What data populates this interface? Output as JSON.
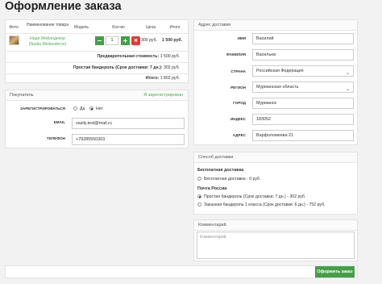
{
  "page": {
    "title": "Оформление заказа"
  },
  "order": {
    "columns": [
      "Фото",
      "Наименование товара",
      "Модель",
      "Кол-во",
      "Цена",
      "Итого"
    ],
    "item": {
      "name": "Надя Мейлндекор (Nadia Meilandecor)",
      "qty": "1",
      "price": "300 руб.",
      "total": "1 500 руб."
    },
    "subtotal_label": "Предварительная стоимость:",
    "subtotal_value": "1 500 руб.",
    "shipping_label": "Простая бандероль (Срок доставки: 7 дн.):",
    "shipping_value": "302 руб.",
    "grand_label": "Итого:",
    "grand_value": "1 802 руб."
  },
  "buyer": {
    "title": "Покупатель",
    "registered_link": "Я зарегистрирован",
    "register_label": "ЗАРЕГИСТРИРОВАТЬСЯ",
    "yes": "Да",
    "no": "Нет",
    "selected": "no",
    "email_label": "EMAIL",
    "email_value": "vasily.test@mail.ru",
    "phone_label": "ТЕЛЕФОН",
    "phone_value": "+79285550303"
  },
  "address": {
    "title": "Адрес доставки",
    "fields": {
      "name": {
        "label": "ИМЯ",
        "value": "Василий"
      },
      "surname": {
        "label": "ФАМИЛИЯ",
        "value": "Васильев"
      },
      "country": {
        "label": "СТРАНА",
        "value": "Российская Федерация"
      },
      "region": {
        "label": "РЕГИОН",
        "value": "Мурманская область"
      },
      "city": {
        "label": "ГОРОД",
        "value": "Мурманск"
      },
      "zip": {
        "label": "ИНДЕКС",
        "value": "183052"
      },
      "addr": {
        "label": "АДРЕС",
        "value": "Варфоломеева 21"
      }
    }
  },
  "delivery": {
    "title": "Способ доставки",
    "free_heading": "Бесплатная доставка",
    "free_option": "Бесплатная доставка - 0 руб.",
    "post_heading": "Почта России",
    "post_option1": "Простая бандероль (Срок доставки: 7 дн.) - 302 руб.",
    "post_option2": "Заказная бандероль 1 класса (Срок доставки: 6 дн.) - 752 руб.",
    "selected": "post_option1"
  },
  "comment": {
    "title": "Комментарий",
    "placeholder": "Комментарий"
  },
  "submit_label": "Оформить заказ"
}
